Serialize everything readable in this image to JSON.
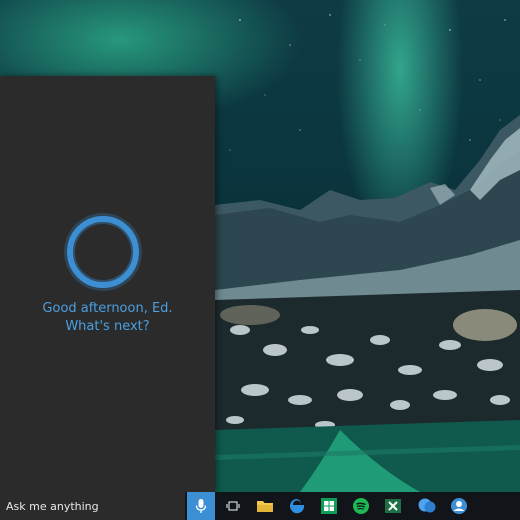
{
  "cortana": {
    "greeting_line1": "Good afternoon, Ed.",
    "greeting_line2": "What's next?",
    "ring_color": "#3d8fd4",
    "text_color": "#4b9fe1"
  },
  "taskbar": {
    "search_label": "Ask me anything",
    "mic_icon": "microphone-icon",
    "apps": [
      "task-view-icon",
      "file-explorer-icon",
      "edge-browser-icon",
      "store-icon",
      "spotify-icon",
      "excel-icon",
      "chat-icon",
      "user-account-icon"
    ]
  }
}
